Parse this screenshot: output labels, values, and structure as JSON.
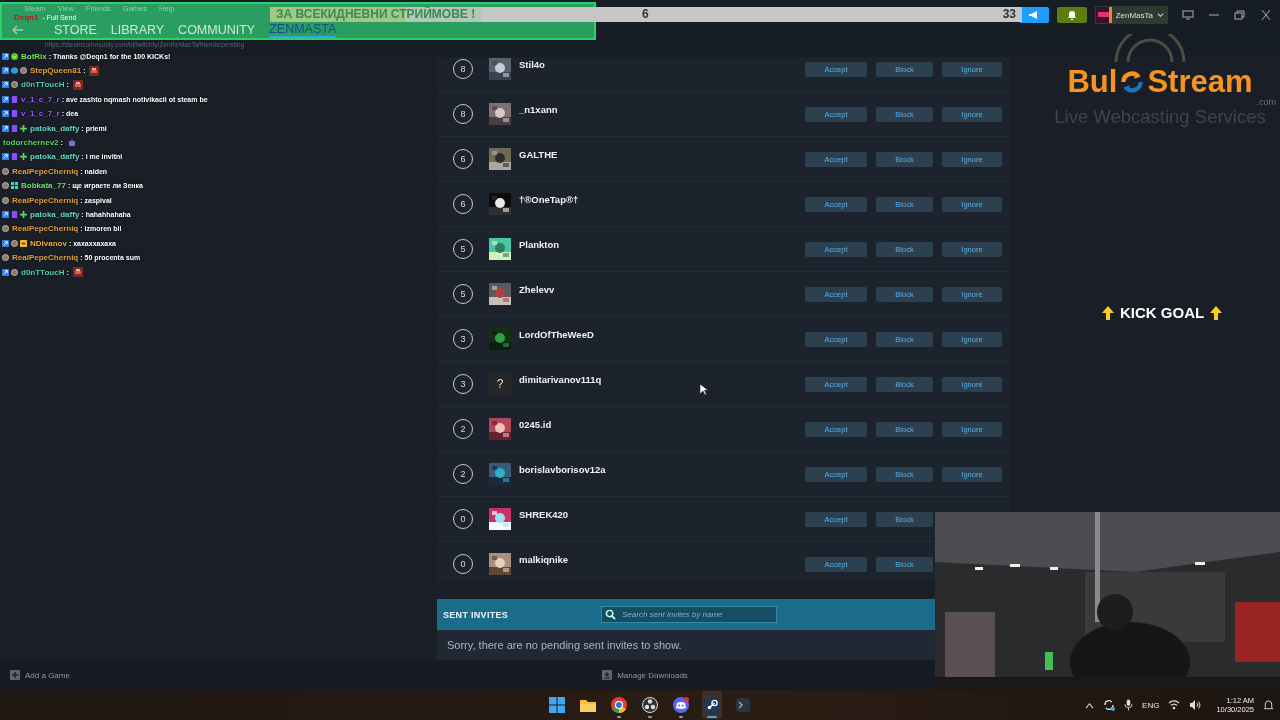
{
  "menu": [
    "Steam",
    "View",
    "Friends",
    "Games",
    "Help"
  ],
  "alert": {
    "name": "Deqn1",
    "text": "- Full Send"
  },
  "nav": [
    {
      "label": "STORE",
      "selected": false
    },
    {
      "label": "LIBRARY",
      "selected": false
    },
    {
      "label": "COMMUNITY",
      "selected": false
    },
    {
      "label": "ZENMASTA",
      "selected": true
    }
  ],
  "goal": {
    "banner": "ЗА ВСЕКИДНЕВНИ СТРИЙМОВЕ !",
    "current": "6",
    "target": "33",
    "level": 0.18
  },
  "user": {
    "name": "ZenMasTa"
  },
  "address": "https://steamcommunity.com/id/twitchty/ZenReMasTa/friends/pending",
  "chat": [
    {
      "badges": [
        {
          "kind": "kick"
        },
        {
          "kind": "verified"
        }
      ],
      "user": "BotRix",
      "color": "#7fe05a",
      "text": ": Thanks @Deqn1 for the 100 KICKs!"
    },
    {
      "badges": [
        {
          "kind": "kick"
        },
        {
          "kind": "gift"
        },
        {
          "kind": "og"
        }
      ],
      "user": "StepQueen81",
      "color": "#e8a33c",
      "text": ":",
      "emote": {
        "kind": "tile"
      }
    },
    {
      "badges": [
        {
          "kind": "kick"
        },
        {
          "kind": "og"
        }
      ],
      "user": "d0nTToucH",
      "color": "#4fd0b0",
      "text": ":",
      "emote": {
        "kind": "tile"
      }
    },
    {
      "badges": [
        {
          "kind": "kick"
        },
        {
          "kind": "sub"
        }
      ],
      "user": "v_1_c_7_r",
      "color": "#9b59ff",
      "text": ": ave zashto nqmash notivikacii ot steam be"
    },
    {
      "badges": [
        {
          "kind": "kick"
        },
        {
          "kind": "sub"
        }
      ],
      "user": "v_1_c_7_r",
      "color": "#9b59ff",
      "text": ": dea"
    },
    {
      "badges": [
        {
          "kind": "kick"
        },
        {
          "kind": "sub"
        },
        {
          "kind": "plus"
        }
      ],
      "user": "patoka_daffy",
      "color": "#66d9c0",
      "text": ": priemi"
    },
    {
      "user": "todorchernev2",
      "color": "#58d65c",
      "text": ":",
      "emote": {
        "kind": "robot"
      }
    },
    {
      "badges": [
        {
          "kind": "kick"
        },
        {
          "kind": "sub"
        },
        {
          "kind": "plus"
        }
      ],
      "user": "patoka_daffy",
      "color": "#66d9c0",
      "text": ": i me invitni"
    },
    {
      "badges": [
        {
          "kind": "og"
        }
      ],
      "user": "RealPepeCherniq",
      "color": "#e0a040",
      "text": ": naiden"
    },
    {
      "badges": [
        {
          "kind": "og"
        },
        {
          "kind": "grid"
        }
      ],
      "user": "Bobkata_77",
      "color": "#6ee06e",
      "text": ": ще играете ли Зенка"
    },
    {
      "badges": [
        {
          "kind": "og"
        }
      ],
      "user": "RealPepeCherniq",
      "color": "#e0a040",
      "text": ": zaspival"
    },
    {
      "badges": [
        {
          "kind": "kick"
        },
        {
          "kind": "sub"
        },
        {
          "kind": "plus"
        }
      ],
      "user": "patoka_daffy",
      "color": "#66d9c0",
      "text": ": hahahhahaha"
    },
    {
      "badges": [
        {
          "kind": "og"
        }
      ],
      "user": "RealPepeCherniq",
      "color": "#e0a040",
      "text": ": izmoren bil"
    },
    {
      "badges": [
        {
          "kind": "kick"
        },
        {
          "kind": "og"
        },
        {
          "kind": "crown"
        }
      ],
      "user": "NDIvanov",
      "color": "#f0b030",
      "text": ": xaxaxxaxaxa"
    },
    {
      "badges": [
        {
          "kind": "og"
        }
      ],
      "user": "RealPepeCherniq",
      "color": "#e0a040",
      "text": ": 50 procenta sum"
    },
    {
      "badges": [
        {
          "kind": "kick"
        },
        {
          "kind": "og"
        }
      ],
      "user": "d0nTToucH",
      "color": "#4fd0b0",
      "text": ":",
      "emote": {
        "kind": "tile"
      }
    }
  ],
  "friends": [
    {
      "steam_level": "8",
      "name": "Stil4o",
      "avatar": {
        "kind": "picture"
      },
      "buttons": [
        {
          "kind": "accept",
          "label": "Accept"
        },
        {
          "kind": "block",
          "label": "Block"
        },
        {
          "kind": "ignore",
          "label": "Ignore"
        }
      ]
    },
    {
      "steam_level": "8",
      "name": "_n1xann",
      "avatar": {
        "kind": "picture"
      },
      "buttons": [
        {
          "kind": "accept",
          "label": "Accept"
        },
        {
          "kind": "block",
          "label": "Block"
        },
        {
          "kind": "ignore",
          "label": "Ignore"
        }
      ]
    },
    {
      "steam_level": "6",
      "name": "GALTHE",
      "avatar": {
        "kind": "picture"
      },
      "buttons": [
        {
          "kind": "accept",
          "label": "Accept"
        },
        {
          "kind": "block",
          "label": "Block"
        },
        {
          "kind": "ignore",
          "label": "Ignore"
        }
      ]
    },
    {
      "steam_level": "6",
      "name": "†®OneTap®†",
      "avatar": {
        "kind": "picture"
      },
      "buttons": [
        {
          "kind": "accept",
          "label": "Accept"
        },
        {
          "kind": "block",
          "label": "Block"
        },
        {
          "kind": "ignore",
          "label": "Ignore"
        }
      ]
    },
    {
      "steam_level": "5",
      "name": "Plankton",
      "avatar": {
        "kind": "picture"
      },
      "buttons": [
        {
          "kind": "accept",
          "label": "Accept"
        },
        {
          "kind": "block",
          "label": "Block"
        },
        {
          "kind": "ignore",
          "label": "Ignore"
        }
      ]
    },
    {
      "steam_level": "5",
      "name": "Zhelevv",
      "avatar": {
        "kind": "picture"
      },
      "buttons": [
        {
          "kind": "accept",
          "label": "Accept"
        },
        {
          "kind": "block",
          "label": "Block"
        },
        {
          "kind": "ignore",
          "label": "Ignore"
        }
      ]
    },
    {
      "steam_level": "3",
      "name": "LordOfTheWeeD",
      "avatar": {
        "kind": "picture"
      },
      "buttons": [
        {
          "kind": "accept",
          "label": "Accept"
        },
        {
          "kind": "block",
          "label": "Block"
        },
        {
          "kind": "ignore",
          "label": "Ignore"
        }
      ]
    },
    {
      "steam_level": "3",
      "name": "dimitarivanov111q",
      "avatar": {
        "kind": "placeholder",
        "glyph": "?"
      },
      "buttons": [
        {
          "kind": "accept",
          "label": "Accept"
        },
        {
          "kind": "block",
          "label": "Block"
        },
        {
          "kind": "ignore",
          "label": "Ignore"
        }
      ]
    },
    {
      "steam_level": "2",
      "name": "0245.id",
      "avatar": {
        "kind": "picture"
      },
      "buttons": [
        {
          "kind": "accept",
          "label": "Accept"
        },
        {
          "kind": "block",
          "label": "Block"
        },
        {
          "kind": "ignore",
          "label": "Ignore"
        }
      ]
    },
    {
      "steam_level": "2",
      "name": "borislavborisov12a",
      "avatar": {
        "kind": "picture"
      },
      "buttons": [
        {
          "kind": "accept",
          "label": "Accept"
        },
        {
          "kind": "block",
          "label": "Block"
        },
        {
          "kind": "ignore",
          "label": "Ignore"
        }
      ]
    },
    {
      "steam_level": "0",
      "name": "SHREK420",
      "avatar": {
        "kind": "picture"
      },
      "buttons": [
        {
          "kind": "accept",
          "label": "Accept"
        },
        {
          "kind": "block",
          "label": "Block"
        }
      ]
    },
    {
      "steam_level": "0",
      "name": "malkiqnike",
      "avatar": {
        "kind": "picture"
      },
      "buttons": [
        {
          "kind": "accept",
          "label": "Accept"
        },
        {
          "kind": "block",
          "label": "Block"
        }
      ]
    }
  ],
  "sent_invites": {
    "title": "SENT INVITES",
    "placeholder": "Search sent invites by name",
    "empty_message": "Sorry, there are no pending sent invites to show."
  },
  "logo": {
    "part_1": "Bul",
    "part_2": "Stream",
    "suffix": ".com",
    "tagline": "Live Webcasting Services"
  },
  "kick_goal": "KICK GOAL",
  "webcam": {
    "kind": "picture"
  },
  "bottom_bar": {
    "add_game": "Add a Game",
    "downloads": "Manage Downloads"
  },
  "taskbar": {
    "apps": [
      {
        "kind": "windows",
        "running": false,
        "selected": false
      },
      {
        "kind": "folder",
        "running": false,
        "selected": false
      },
      {
        "kind": "chrome",
        "running": true,
        "selected": false
      },
      {
        "kind": "obs",
        "running": true,
        "selected": false
      },
      {
        "kind": "discord",
        "running": true,
        "selected": false
      },
      {
        "kind": "steam",
        "running": true,
        "selected": true
      },
      {
        "kind": "terminal",
        "running": false,
        "selected": false
      }
    ],
    "language": "ENG",
    "time": "1:12 AM",
    "date": "10/30/2025"
  }
}
